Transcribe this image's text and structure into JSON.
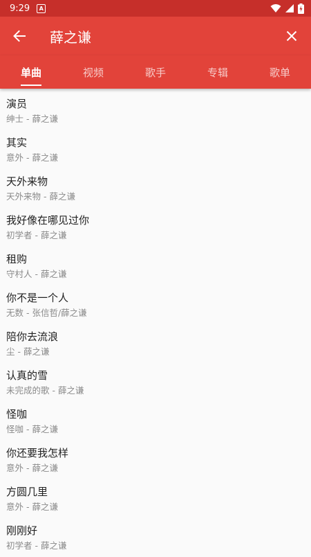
{
  "status": {
    "time": "9:29",
    "notif": "A"
  },
  "header": {
    "title": "薛之谦"
  },
  "tabs": [
    {
      "label": "单曲"
    },
    {
      "label": "视频"
    },
    {
      "label": "歌手"
    },
    {
      "label": "专辑"
    },
    {
      "label": "歌单"
    }
  ],
  "songs": [
    {
      "title": "演员",
      "sub": "绅士 - 薛之谦"
    },
    {
      "title": "其实",
      "sub": "意外 - 薛之谦"
    },
    {
      "title": "天外来物",
      "sub": "天外来物 - 薛之谦"
    },
    {
      "title": "我好像在哪见过你",
      "sub": "初学者 - 薛之谦"
    },
    {
      "title": "租购",
      "sub": "守村人 - 薛之谦"
    },
    {
      "title": "你不是一个人",
      "sub": "无数 - 张信哲/薛之谦"
    },
    {
      "title": "陪你去流浪",
      "sub": "尘 - 薛之谦"
    },
    {
      "title": "认真的雪",
      "sub": "未完成的歌 - 薛之谦"
    },
    {
      "title": "怪咖",
      "sub": "怪咖 - 薛之谦"
    },
    {
      "title": "你还要我怎样",
      "sub": "意外 - 薛之谦"
    },
    {
      "title": "方圆几里",
      "sub": "意外 - 薛之谦"
    },
    {
      "title": "刚刚好",
      "sub": "初学者 - 薛之谦"
    }
  ]
}
